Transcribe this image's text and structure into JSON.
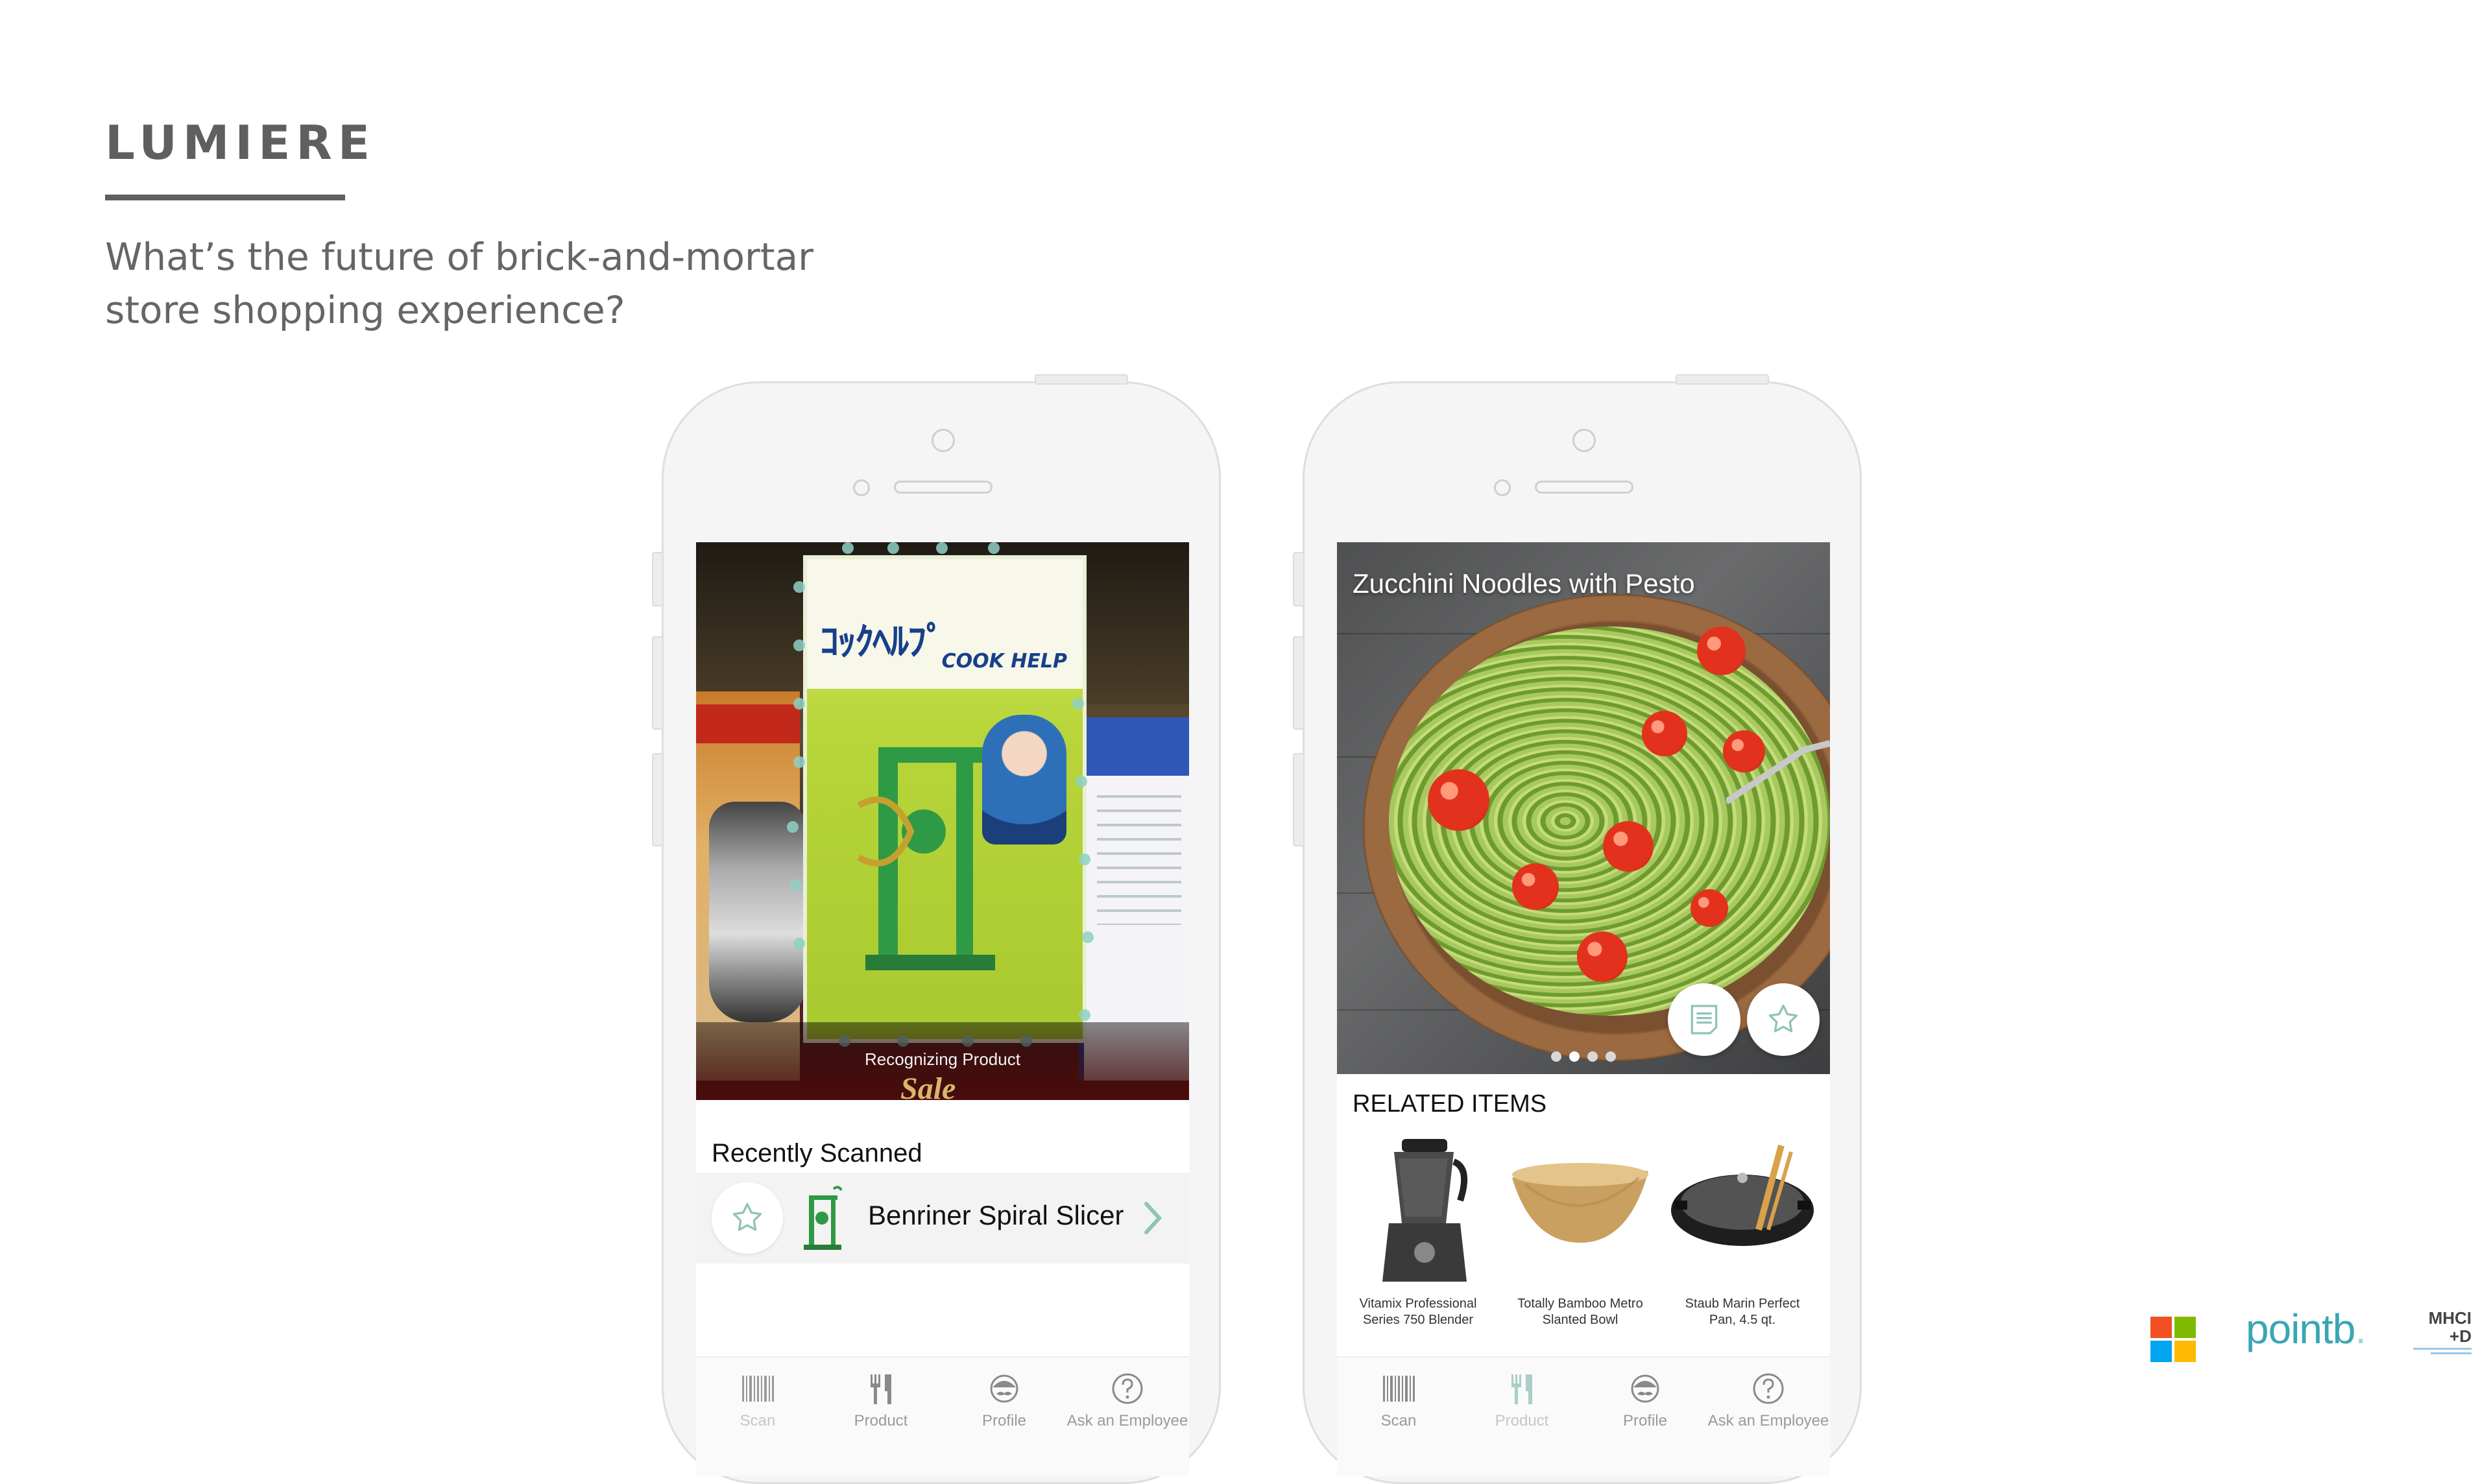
{
  "header": {
    "brand": "LUMIERE",
    "tagline_line1": "What’s the future of brick-and-mortar",
    "tagline_line2": "store shopping experience?"
  },
  "scan_screen": {
    "status_overlay": "Recognizing Product",
    "recently_scanned_title": "Recently Scanned",
    "recent_item": {
      "name": "Benriner Spiral Slicer"
    },
    "tabs": [
      {
        "label": "Scan",
        "icon": "barcode-icon",
        "active": true
      },
      {
        "label": "Product",
        "icon": "fork-knife-icon",
        "active": false
      },
      {
        "label": "Profile",
        "icon": "profile-mustache-icon",
        "active": false
      },
      {
        "label": "Ask an Employee",
        "icon": "question-circle-icon",
        "active": false
      }
    ]
  },
  "product_screen": {
    "hero_title": "Zucchini Noodles with Pesto",
    "carousel": {
      "pages": 4,
      "current": 2
    },
    "related_title": "RELATED ITEMS",
    "related_items": [
      {
        "line1": "Vitamix Professional",
        "line2": "Series 750 Blender",
        "icon": "blender-image"
      },
      {
        "line1": "Totally Bamboo Metro",
        "line2": "Slanted Bowl",
        "icon": "bowl-image"
      },
      {
        "line1": "Staub Marin Perfect",
        "line2": "Pan, 4.5 qt.",
        "icon": "pan-image"
      }
    ],
    "tabs": [
      {
        "label": "Scan",
        "icon": "barcode-icon",
        "active": false
      },
      {
        "label": "Product",
        "icon": "fork-knife-icon",
        "active": true
      },
      {
        "label": "Profile",
        "icon": "profile-mustache-icon",
        "active": false
      },
      {
        "label": "Ask an Employee",
        "icon": "question-circle-icon",
        "active": false
      }
    ]
  },
  "partners": {
    "pointb": "pointb",
    "mhci_line1": "MHCI",
    "mhci_line2": "+D"
  },
  "colors": {
    "accent_teal": "#8fc2b8",
    "heading_gray": "#5f5f5f",
    "pointb_teal": "#3aa6b3"
  }
}
